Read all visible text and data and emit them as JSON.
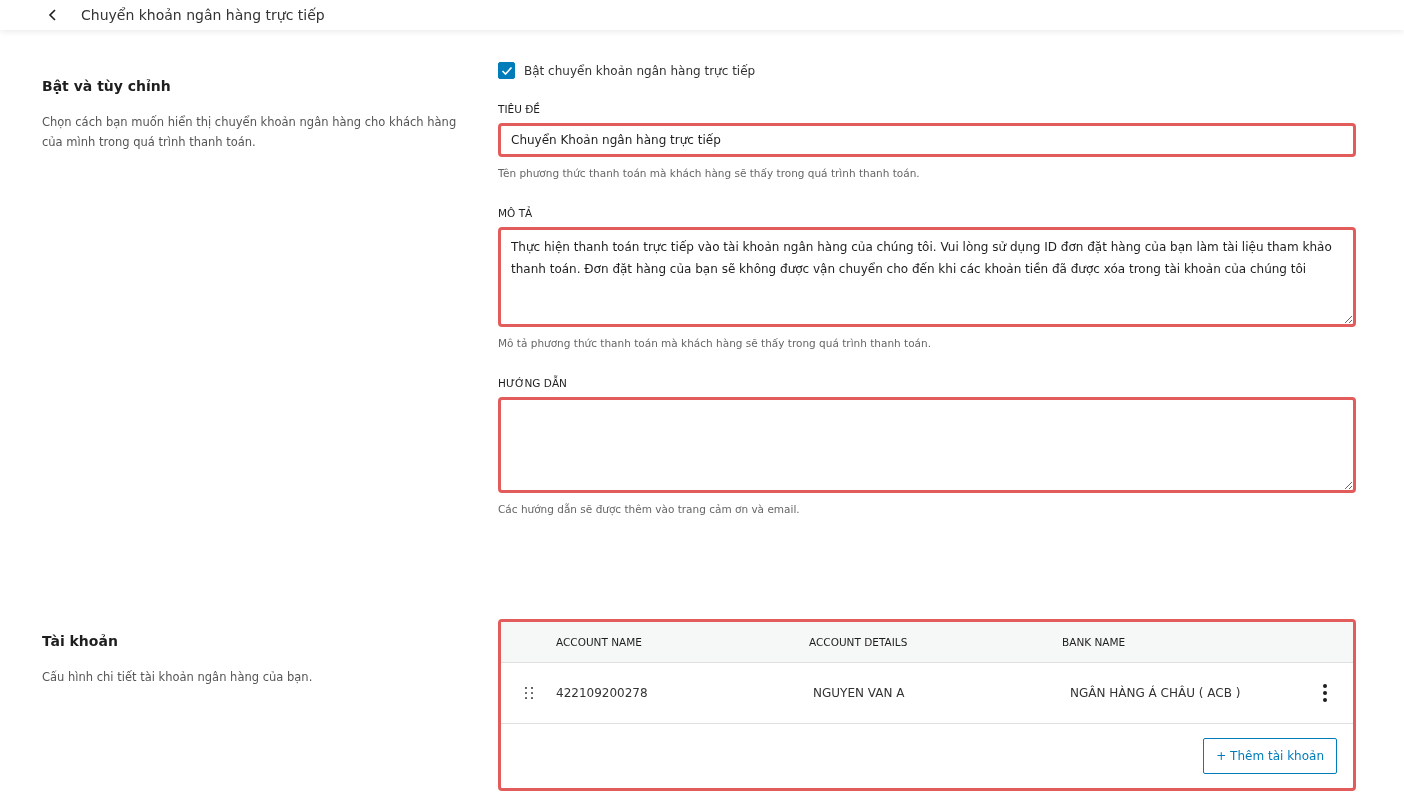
{
  "header": {
    "title": "Chuyển khoản ngân hàng trực tiếp"
  },
  "sections": [
    {
      "heading": "Bật và tùy chỉnh",
      "description": "Chọn cách bạn muốn hiển thị chuyển khoản ngân hàng cho khách hàng của mình trong quá trình thanh toán."
    },
    {
      "heading": "Tài khoản",
      "description": "Cấu hình chi tiết tài khoản ngân hàng của bạn."
    }
  ],
  "enable": {
    "label": "Bật chuyển khoản ngân hàng trực tiếp",
    "checked": true
  },
  "fields": [
    {
      "kind": "input",
      "label": "TIÊU ĐỀ",
      "value": "Chuyển Khoản ngân hàng trực tiếp",
      "help": "Tên phương thức thanh toán mà khách hàng sẽ thấy trong quá trình thanh toán.",
      "highlighted": true
    },
    {
      "kind": "textarea",
      "label": "MÔ TẢ",
      "value": "Thực hiện thanh toán trực tiếp vào tài khoản ngân hàng của chúng tôi. Vui lòng sử dụng ID đơn đặt hàng của bạn làm tài liệu tham khảo thanh toán. Đơn đặt hàng của bạn sẽ không được vận chuyển cho đến khi các khoản tiền đã được xóa trong tài khoản của chúng tôi",
      "help": "Mô tả phương thức thanh toán mà khách hàng sẽ thấy trong quá trình thanh toán.",
      "highlighted": true
    },
    {
      "kind": "textarea",
      "label": "HƯỚNG DẪN",
      "help": "Các hướng dẫn sẽ được thêm vào trang cảm ơn và email.",
      "highlighted": true
    }
  ],
  "accounts": {
    "highlighted": true,
    "columns": [
      "ACCOUNT NAME",
      "ACCOUNT DETAILS",
      "BANK NAME"
    ],
    "rows": [
      {
        "cells": [
          "422109200278",
          "NGUYEN VAN A",
          "NGÂN HÀNG Á CHÂU ( ACB )"
        ]
      }
    ],
    "add_button": "+ Thêm tài khoản"
  }
}
